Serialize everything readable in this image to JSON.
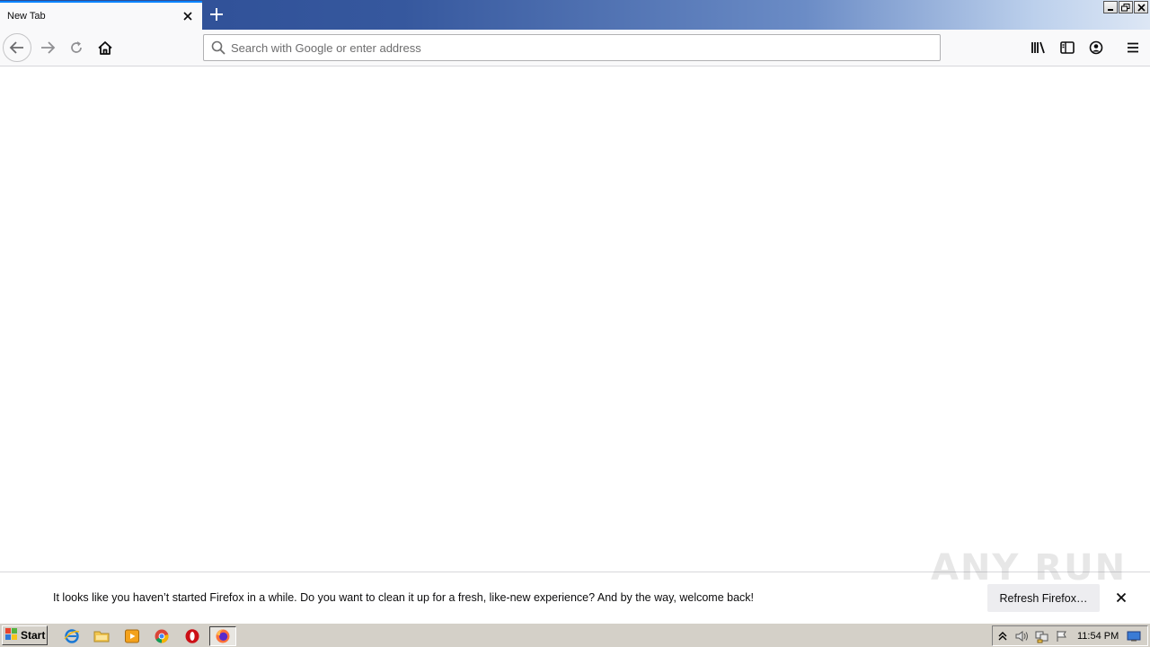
{
  "browser": {
    "tab": {
      "title": "New Tab"
    },
    "urlbar": {
      "placeholder": "Search with Google or enter address",
      "value": ""
    }
  },
  "notification": {
    "message": "It looks like you haven’t started Firefox in a while. Do you want to clean it up for a fresh, like-new experience? And by the way, welcome back!",
    "button_label": "Refresh Firefox…",
    "watermark": "ANY RUN"
  },
  "taskbar": {
    "start_label": "Start",
    "apps": [
      "internet-explorer",
      "file-explorer",
      "media-player",
      "chrome",
      "opera",
      "firefox"
    ],
    "clock": "11:54 PM"
  },
  "colors": {
    "accent": "#0a84ff",
    "taskbar": "#d4d0c8",
    "titlebar": "#2b4b93"
  }
}
